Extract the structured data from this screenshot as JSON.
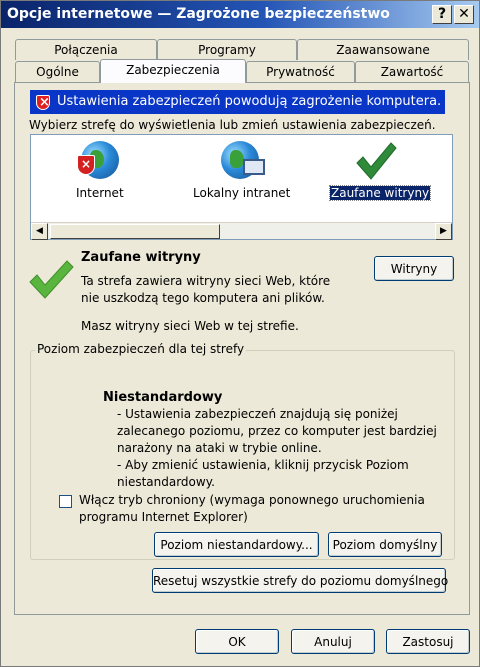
{
  "window": {
    "title": "Opcje internetowe — Zagrożone bezpieczeństwo",
    "help_glyph": "?",
    "close_glyph": "✕"
  },
  "tabs": {
    "row1": [
      "Połączenia",
      "Programy",
      "Zaawansowane"
    ],
    "row2": [
      "Ogólne",
      "Zabezpieczenia",
      "Prywatność",
      "Zawartość"
    ],
    "active": "Zabezpieczenia"
  },
  "security": {
    "banner": "Ustawienia zabezpieczeń powodują zagrożenie komputera.",
    "banner_icon": "shield-warning-icon",
    "zones_label": "Wybierz strefę do wyświetlenia lub zmień ustawienia zabezpieczeń.",
    "zones": [
      {
        "label": "Internet",
        "icon": "globe-blocked-icon"
      },
      {
        "label": "Lokalny intranet",
        "icon": "globe-computer-icon"
      },
      {
        "label": "Zaufane witryny",
        "icon": "checkmark-icon",
        "selected": true
      }
    ],
    "zone_info": {
      "title": "Zaufane witryny",
      "description": "Ta strefa zawiera witryny sieci Web, które nie uszkodzą tego komputera ani plików.",
      "note": "Masz witryny sieci Web w tej strefie.",
      "sites_button": "Witryny"
    },
    "level": {
      "group_label": "Poziom zabezpieczeń dla tej strefy",
      "title": "Niestandardowy",
      "lines": [
        "- Ustawienia zabezpieczeń znajdują się poniżej",
        "zalecanego poziomu, przez co komputer jest bardziej",
        "narażony na ataki w trybie online.",
        "- Aby zmienić ustawienia, kliknij przycisk Poziom",
        "niestandardowy."
      ],
      "protected_mode_line1": "Włącz tryb chroniony (wymaga ponownego uruchomienia",
      "protected_mode_line2": "programu Internet Explorer)",
      "protected_mode_checked": false,
      "custom_level_button": "Poziom niestandardowy...",
      "default_level_button": "Poziom domyślny"
    },
    "reset_all_button": "Resetuj wszystkie strefy do poziomu domyślnego"
  },
  "footer": {
    "ok": "OK",
    "cancel": "Anuluj",
    "apply": "Zastosuj"
  }
}
